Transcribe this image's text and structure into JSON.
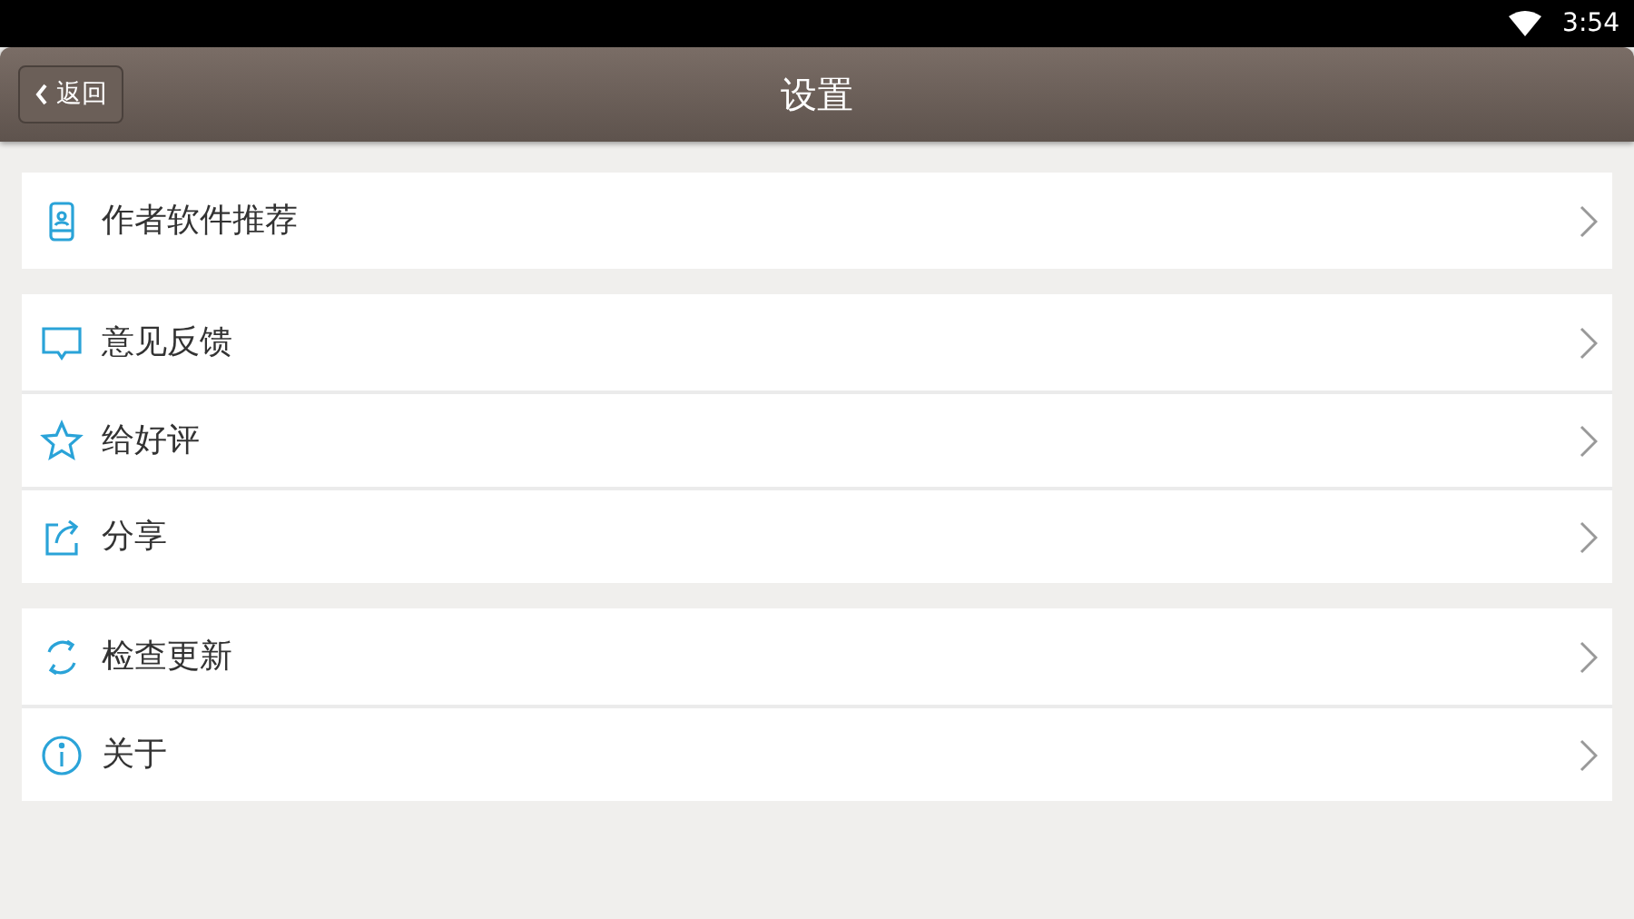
{
  "status_bar": {
    "time": "3:54"
  },
  "header": {
    "back_button": "返回",
    "title": "设置"
  },
  "groups": [
    {
      "items": [
        {
          "kind": "phone",
          "label": "作者软件推荐"
        }
      ]
    },
    {
      "items": [
        {
          "kind": "chat",
          "label": "意见反馈"
        },
        {
          "kind": "star",
          "label": "给好评"
        },
        {
          "kind": "share",
          "label": "分享"
        }
      ]
    },
    {
      "items": [
        {
          "kind": "refresh",
          "label": "检查更新"
        },
        {
          "kind": "info",
          "label": "关于"
        }
      ]
    }
  ]
}
